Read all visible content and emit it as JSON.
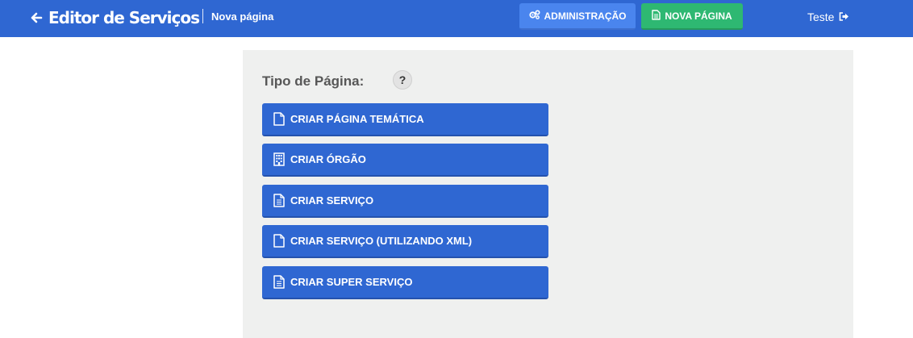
{
  "header": {
    "app_title": "Editor de Serviços",
    "page_subtitle": "Nova página",
    "admin_label": "ADMINISTRAÇÃO",
    "new_page_label": "NOVA PÁGINA",
    "user_label": "Teste",
    "colors": {
      "bar": "#2f67d2",
      "admin_button": "#4a85ee",
      "new_page_button": "#2eb872"
    }
  },
  "main": {
    "section_title": "Tipo de Página:",
    "help_label": "?",
    "buttons": [
      {
        "label": "CRIAR PÁGINA TEMÁTICA",
        "icon": "file-icon"
      },
      {
        "label": "CRIAR ÓRGÃO",
        "icon": "building-icon"
      },
      {
        "label": "CRIAR SERVIÇO",
        "icon": "file-text-icon"
      },
      {
        "label": "CRIAR SERVIÇO (UTILIZANDO XML)",
        "icon": "file-icon"
      },
      {
        "label": "CRIAR SUPER SERVIÇO",
        "icon": "file-text-icon"
      }
    ],
    "colors": {
      "panel": "#eff0ef",
      "button": "#2f67d2"
    }
  }
}
